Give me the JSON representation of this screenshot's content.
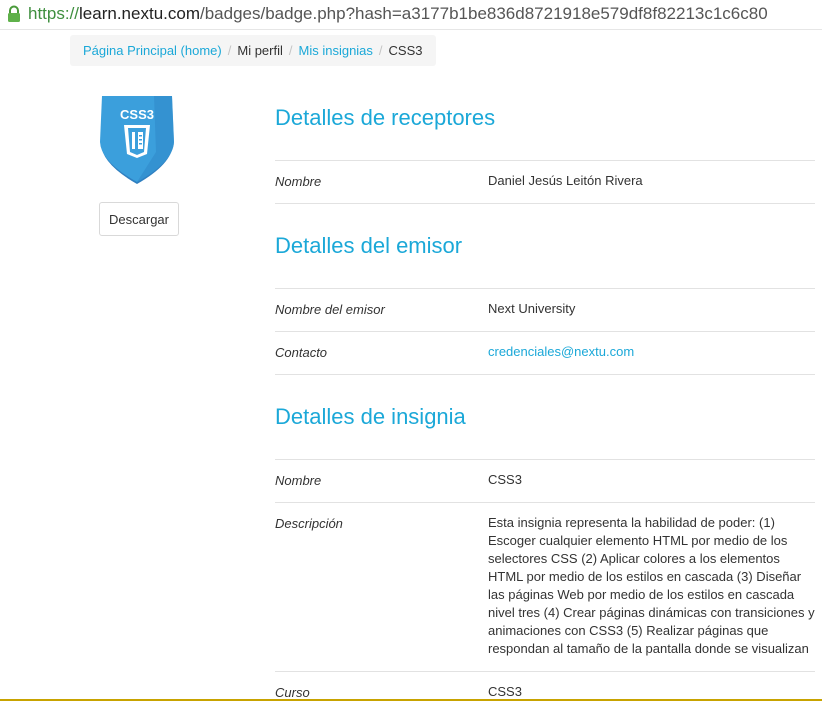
{
  "browser": {
    "url_protocol": "https://",
    "url_host": "learn.nextu.com",
    "url_path": "/badges/badge.php?hash=a3177b1be836d8721918e579df8f82213c1c6c80"
  },
  "breadcrumb": {
    "items": [
      "Página Principal (home)",
      "Mi perfil",
      "Mis insignias",
      "CSS3"
    ],
    "separator": "/"
  },
  "badge": {
    "label": "CSS3",
    "colors": {
      "shield": "#3b9fdc",
      "shield_dark": "#2f7fc0",
      "icon": "#ffffff"
    }
  },
  "download_button": "Descargar",
  "sections": {
    "recipient": {
      "title": "Detalles de receptores",
      "rows": [
        {
          "label": "Nombre",
          "value": "Daniel Jesús Leitón Rivera"
        }
      ]
    },
    "issuer": {
      "title": "Detalles del emisor",
      "rows": [
        {
          "label": "Nombre del emisor",
          "value": "Next University"
        },
        {
          "label": "Contacto",
          "value": "credenciales@nextu.com"
        }
      ]
    },
    "badge_details": {
      "title": "Detalles de insignia",
      "rows": [
        {
          "label": "Nombre",
          "value": "CSS3"
        },
        {
          "label": "Descripción",
          "value": "Esta insignia representa la habilidad de poder: (1) Escoger cualquier elemento HTML por medio de los selectores CSS (2) Aplicar colores a los elementos HTML por medio de los estilos en cascada (3) Diseñar las páginas Web por medio de los estilos en cascada nivel tres (4) Crear páginas dinámicas con transiciones y animaciones con CSS3 (5) Realizar páginas que respondan al tamaño de la pantalla donde se visualizan"
        },
        {
          "label": "Curso",
          "value": "CSS3"
        }
      ]
    }
  },
  "colors": {
    "accent": "#1ba8d8",
    "text": "#333333",
    "divider": "#e2e2e2"
  }
}
